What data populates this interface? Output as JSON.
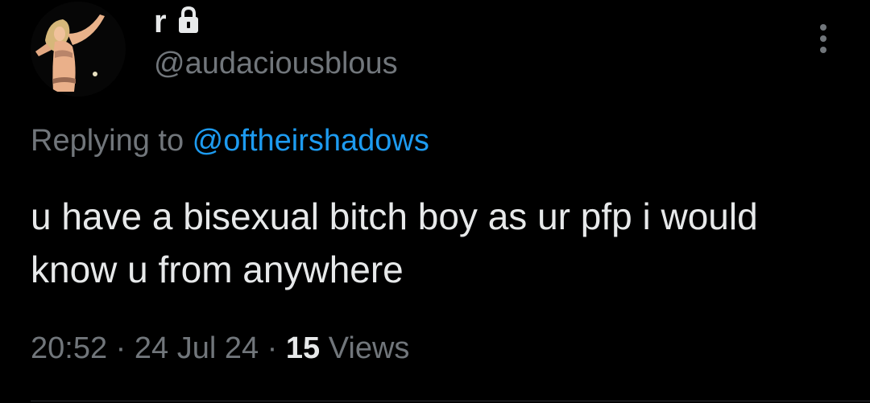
{
  "author": {
    "display_name": "r",
    "handle": "@audaciousblous",
    "avatar_icon": "profile-photo",
    "locked_icon": "lock-icon"
  },
  "reply": {
    "prefix": "Replying to ",
    "handle": "@oftheirshadows"
  },
  "tweet": {
    "text": "u have a bisexual bitch boy as ur pfp i would know u from anywhere"
  },
  "meta": {
    "time": "20:52",
    "separator": "·",
    "date": "24 Jul 24",
    "views_count": "15",
    "views_label": "Views"
  },
  "menu": {
    "icon": "more-vertical-icon"
  },
  "colors": {
    "background": "#000000",
    "primary_text": "#e7e9ea",
    "secondary_text": "#71767b",
    "link": "#1d9bf0"
  }
}
